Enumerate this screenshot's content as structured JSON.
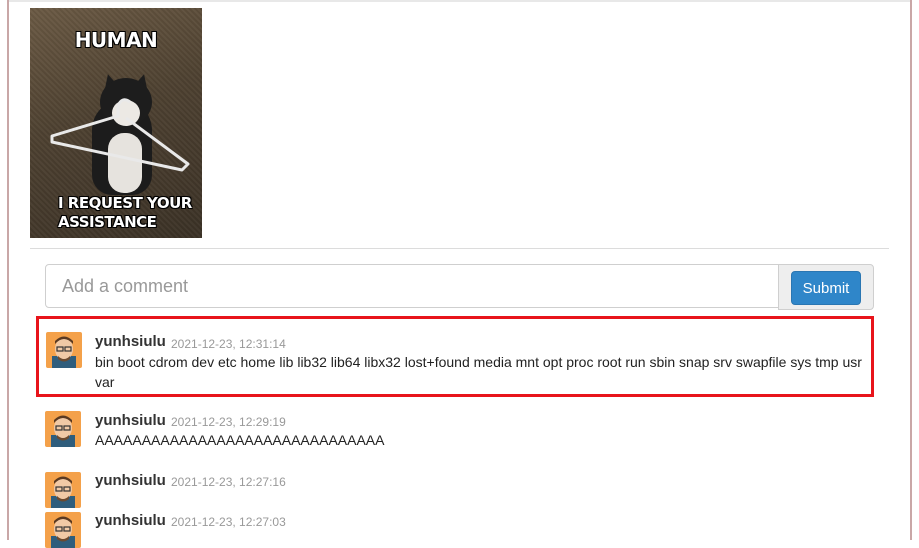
{
  "meme": {
    "caption_top": "HUMAN",
    "caption_bottom_line1": "I REQUEST YOUR",
    "caption_bottom_line2": "ASSISTANCE"
  },
  "comment_form": {
    "placeholder": "Add a comment",
    "submit_label": "Submit"
  },
  "comments": [
    {
      "username": "yunhsiulu",
      "timestamp": "2021-12-23, 12:31:14",
      "text": "bin boot cdrom dev etc home lib lib32 lib64 libx32 lost+found media mnt opt proc root run sbin snap srv swapfile sys tmp usr var"
    },
    {
      "username": "yunhsiulu",
      "timestamp": "2021-12-23, 12:29:19",
      "text": "AAAAAAAAAAAAAAAAAAAAAAAAAAAAAAA"
    },
    {
      "username": "yunhsiulu",
      "timestamp": "2021-12-23, 12:27:16",
      "text": ""
    },
    {
      "username": "yunhsiulu",
      "timestamp": "2021-12-23, 12:27:03",
      "text": ""
    }
  ],
  "colors": {
    "highlight": "#e8141b",
    "submit": "#2f86c9"
  }
}
